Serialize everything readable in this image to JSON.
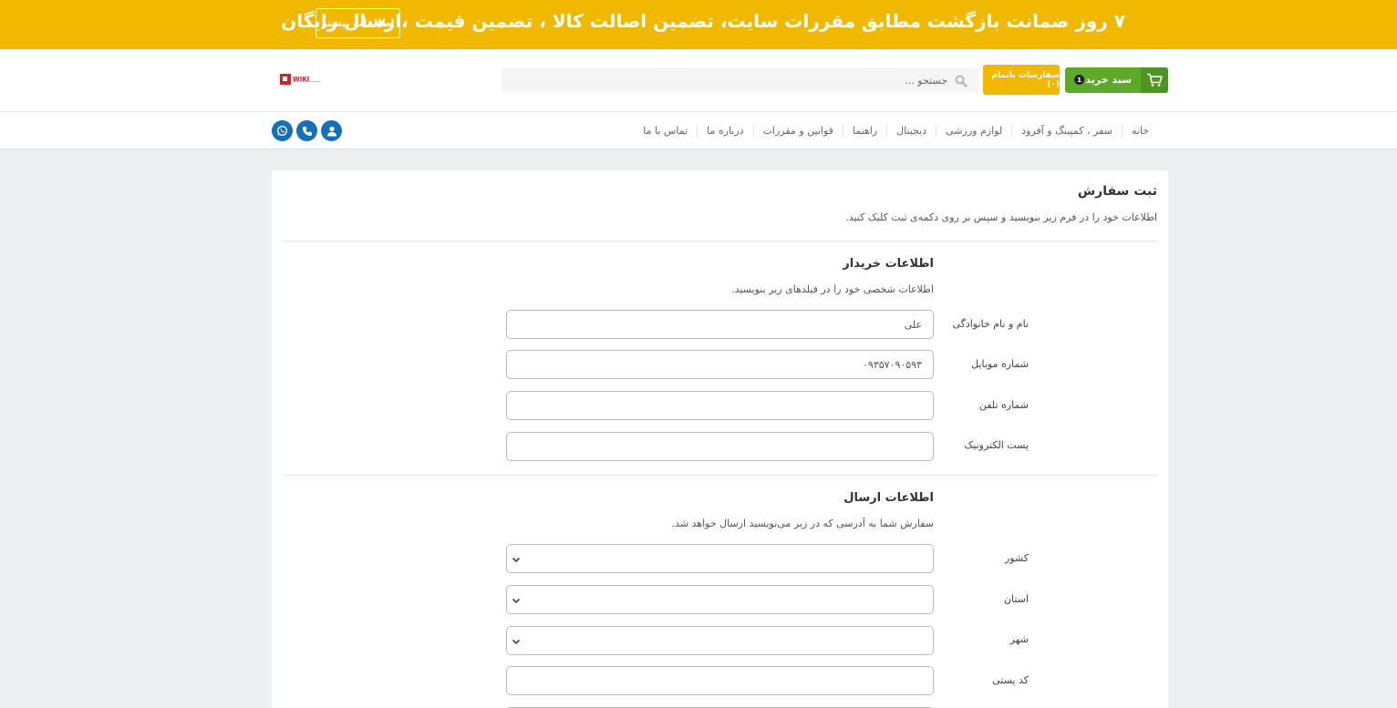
{
  "banner": {
    "text": "۷ روز ضمانت بازگشت مطابق مقررات سایت، تضمین اصالت کالا ، تضمین قیمت ،ارسال رایگان",
    "more_button": "اطلاعات بیشتر"
  },
  "header": {
    "logo_text": "WIKI",
    "search_placeholder": "جستجو ...",
    "incomplete_orders": "سفارشات ناتمام (۰)",
    "cart_label": "سبد خرید",
    "cart_count": "1",
    "accent_yellow": "#f0b800",
    "accent_green": "#5daa2b"
  },
  "nav": {
    "items": [
      "خانه",
      "سفر ، کمپینگ و آفرود",
      "لوازم ورزشی",
      "دیجیتال",
      "راهنما",
      "قوانین و مقررات",
      "درباره ما",
      "تماس با ما"
    ],
    "social_icons": [
      "user-icon",
      "phone-icon",
      "whatsapp-icon"
    ]
  },
  "form": {
    "title": "ثبت سفارش",
    "description": "اطلاعات خود را در فرم زیر بنویسید و سپس بر روی دکمه‌ی ثبت کلیک کنید.",
    "buyer": {
      "title": "اطلاعات خریدار",
      "description": "اطلاعات شخصی خود را در فیلدهای زیر بنویسید.",
      "fields": [
        {
          "label": "نام و نام خانوادگی",
          "value": "علی"
        },
        {
          "label": "شماره موبایل",
          "value": "۰۹۳۵۷۰۹۰۵۹۳"
        },
        {
          "label": "شماره تلفن",
          "value": ""
        },
        {
          "label": "پست الکترونیک",
          "value": ""
        }
      ]
    },
    "shipping": {
      "title": "اطلاعات ارسال",
      "description": "سفارش شما به آدرسی که در زیر می‌نویسید ارسال خواهد شد.",
      "fields": [
        {
          "label": "کشور",
          "type": "select",
          "value": ""
        },
        {
          "label": "استان",
          "type": "select",
          "value": ""
        },
        {
          "label": "شهر",
          "type": "select",
          "value": ""
        },
        {
          "label": "کد پستی",
          "type": "text",
          "value": ""
        }
      ]
    }
  }
}
